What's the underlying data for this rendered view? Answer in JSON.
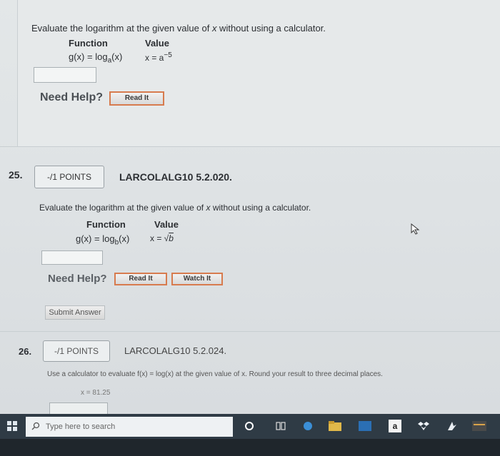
{
  "q24": {
    "prompt_pre": "Evaluate the logarithm at the given value of ",
    "prompt_var": "x",
    "prompt_post": " without using a calculator.",
    "col_function": "Function",
    "col_value": "Value",
    "function_expr": "g(x) = log",
    "function_base": "a",
    "function_arg": "(x)",
    "value_expr": "x = a",
    "value_exp": "−5",
    "need_help": "Need Help?",
    "read_it": "Read It"
  },
  "q25": {
    "number": "25.",
    "points": "-/1 POINTS",
    "code": "LARCOLALG10 5.2.020.",
    "prompt_pre": "Evaluate the logarithm at the given value of ",
    "prompt_var": "x",
    "prompt_post": " without using a calculator.",
    "col_function": "Function",
    "col_value": "Value",
    "function_expr": "g(x) = log",
    "function_base": "b",
    "function_arg": "(x)",
    "value_expr": "x = √",
    "value_rad": "b",
    "need_help": "Need Help?",
    "read_it": "Read It",
    "watch_it": "Watch It",
    "submit": "Submit Answer"
  },
  "q26": {
    "number": "26.",
    "points": "-/1 POINTS",
    "code": "LARCOLALG10 5.2.024.",
    "prompt": "Use a calculator to evaluate f(x) = log(x) at the given value of x. Round your result to three decimal places.",
    "value": "x = 81.25"
  },
  "taskbar": {
    "search_placeholder": "Type here to search",
    "icons": [
      "windows-logo",
      "search-icon",
      "cortana-icon",
      "task-view-icon",
      "edge-icon",
      "file-explorer-icon",
      "store-icon",
      "amazon-icon",
      "dropbox-icon",
      "app-icon",
      "news-icon"
    ]
  },
  "colors": {
    "button_border": "#d77b4e",
    "taskbar": "#2f3b45"
  }
}
